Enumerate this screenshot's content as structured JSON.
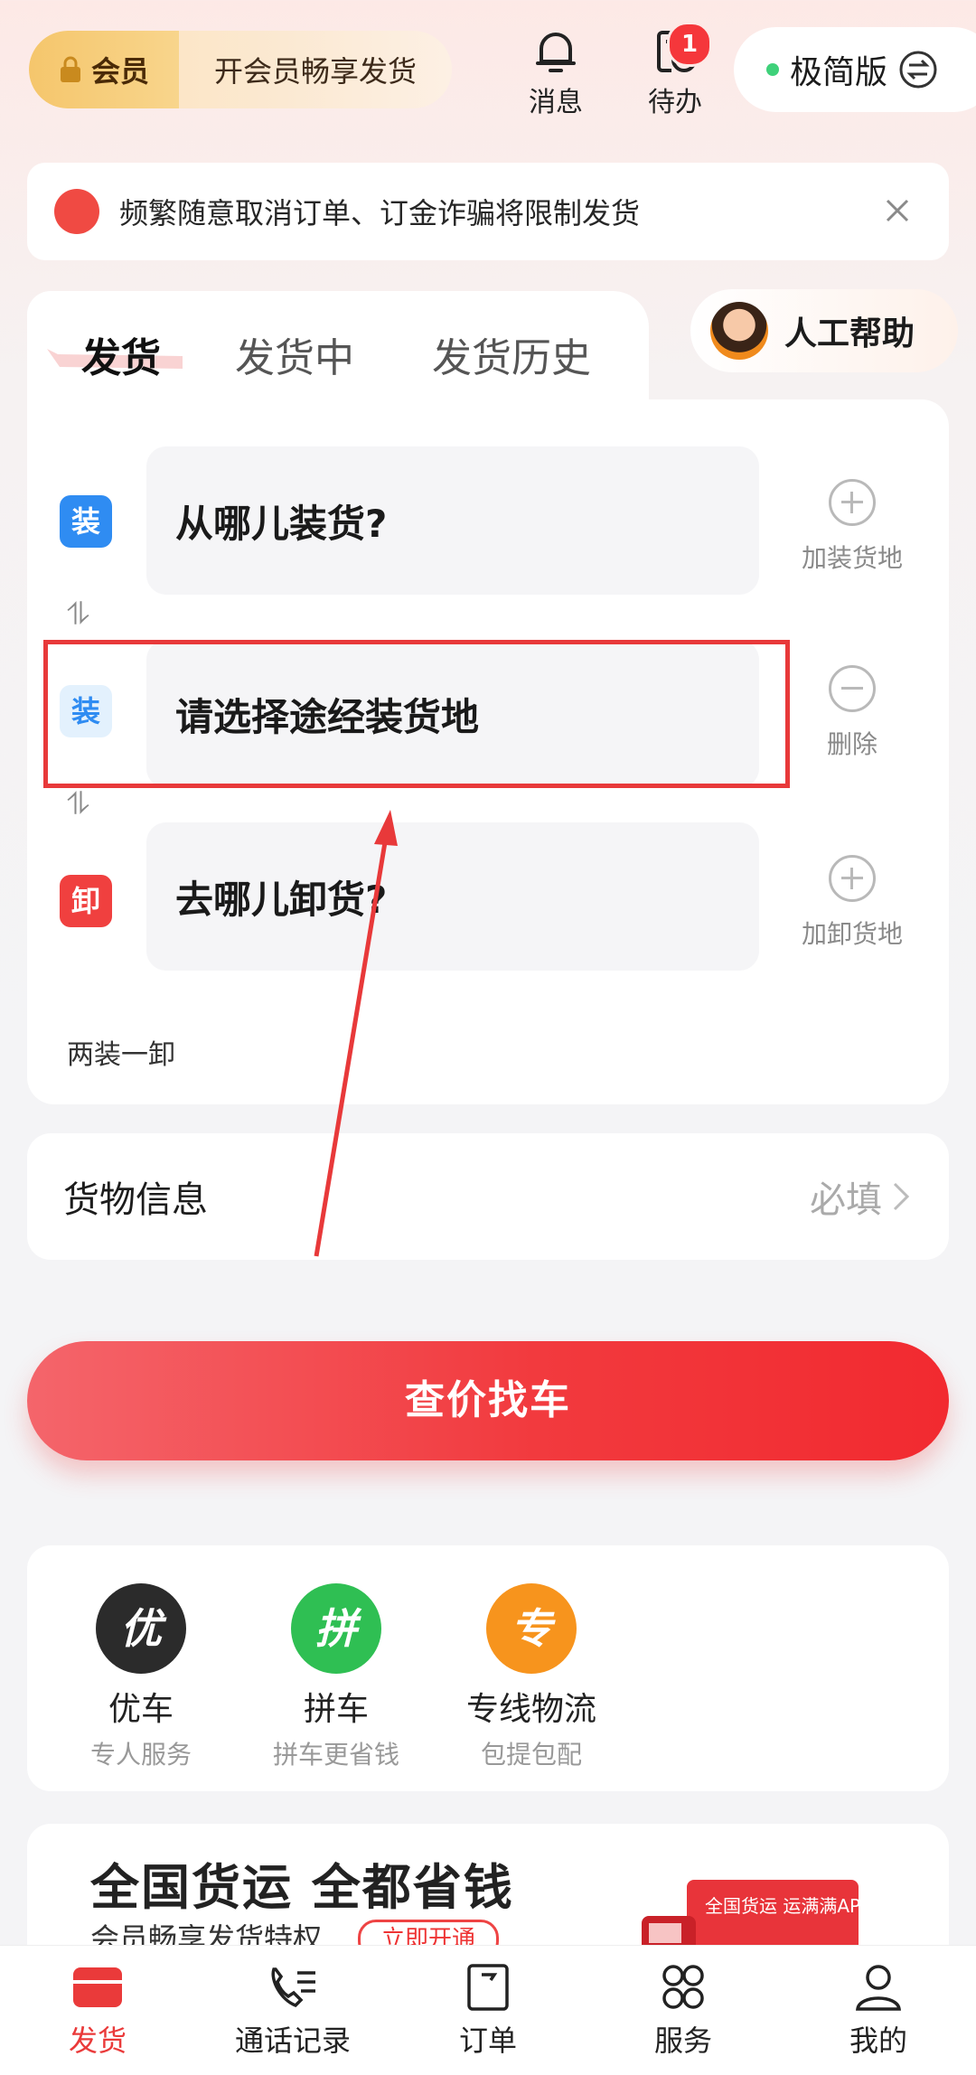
{
  "topbar": {
    "vip_badge": "会员",
    "vip_promo": "开会员畅享发货",
    "messages_label": "消息",
    "todo_label": "待办",
    "todo_count": "1",
    "mode_label": "极简版"
  },
  "notice": {
    "text": "频繁随意取消订单、订金诈骗将限制发货"
  },
  "tabs": [
    {
      "label": "发货"
    },
    {
      "label": "发货中"
    },
    {
      "label": "发货历史"
    }
  ],
  "help": {
    "label": "人工帮助"
  },
  "route": {
    "load": {
      "tag": "装",
      "placeholder": "从哪儿装货?",
      "action": "加装货地"
    },
    "via": {
      "tag": "装",
      "placeholder": "请选择途经装货地",
      "action": "删除"
    },
    "unload": {
      "tag": "卸",
      "placeholder": "去哪儿卸货?",
      "action": "加卸货地"
    },
    "summary": "两装一卸"
  },
  "cargo": {
    "label": "货物信息",
    "required": "必填"
  },
  "primary_button": "查价找车",
  "services": [
    {
      "icon": "优",
      "name": "优车",
      "sub": "专人服务",
      "color": "#2b2b2b"
    },
    {
      "icon": "拼",
      "name": "拼车",
      "sub": "拼车更省钱",
      "color": "#2fbf53"
    },
    {
      "icon": "专",
      "name": "专线物流",
      "sub": "包提包配",
      "color": "#f7941d"
    }
  ],
  "banner": {
    "title": "全国货运 全都省钱",
    "subtitle": "会员畅享发货特权",
    "button": "立即开通",
    "truck_text": "全国货运 运满满APP"
  },
  "nav": [
    {
      "label": "发货",
      "icon": "ship-icon"
    },
    {
      "label": "通话记录",
      "icon": "call-log-icon"
    },
    {
      "label": "订单",
      "icon": "order-icon"
    },
    {
      "label": "服务",
      "icon": "services-icon"
    },
    {
      "label": "我的",
      "icon": "profile-icon"
    }
  ],
  "colors": {
    "accent": "#f23a3e",
    "highlight_box": "#e8393a"
  }
}
